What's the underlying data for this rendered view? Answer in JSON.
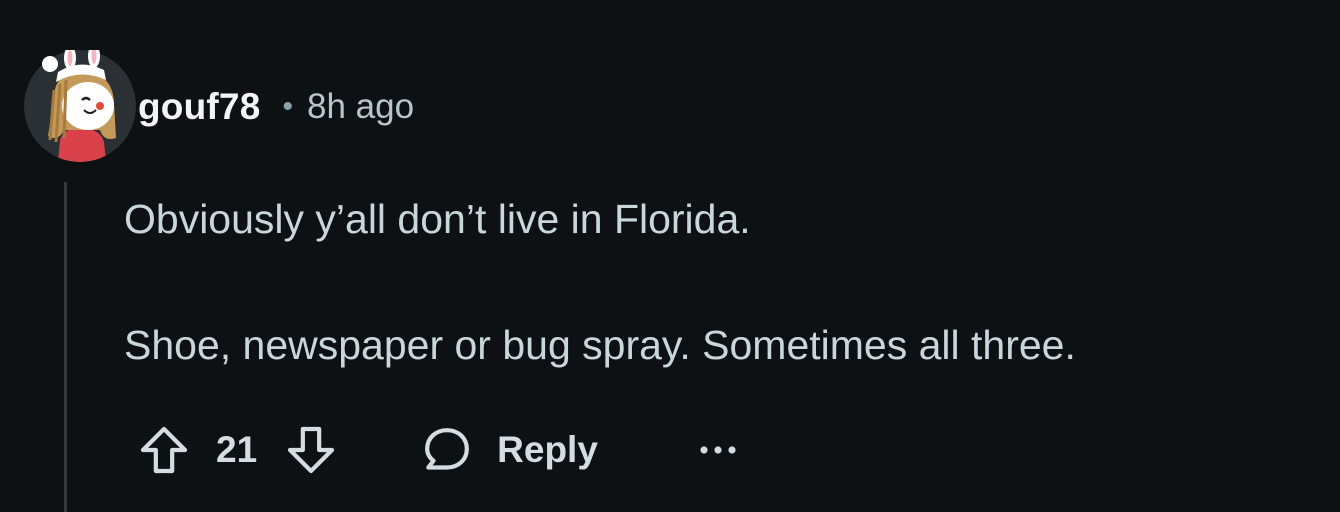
{
  "comment": {
    "username": "gouf78",
    "separator": "•",
    "timestamp": "8h ago",
    "body_paragraphs": [
      "Obviously y’all don’t live in Florida.",
      "Shoe, newspaper or bug spray. Sometimes all three."
    ],
    "score": "21",
    "reply_label": "Reply"
  },
  "icons": {
    "upvote": "arrow-up-icon",
    "downvote": "arrow-down-icon",
    "reply": "speech-bubble-icon",
    "more": "ellipsis-icon",
    "avatar": "user-avatar"
  },
  "colors": {
    "background": "#0e1113",
    "username": "#f2f4f5",
    "meta": "#b7c5cc",
    "body_text": "#c9d6dc",
    "action_text": "#d3dde2",
    "thread_line": "#33393d"
  }
}
